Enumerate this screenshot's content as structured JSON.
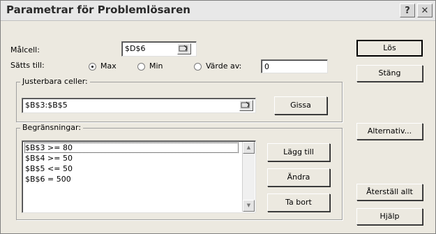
{
  "window": {
    "title": "Parametrar för Problemlösaren",
    "help_glyph": "?",
    "close_glyph": "✕"
  },
  "target": {
    "label": "Målcell:",
    "value": "$D$6"
  },
  "equal_to": {
    "label": "Sätts till:",
    "options": [
      "Max",
      "Min",
      "Värde av:"
    ],
    "selected": "Max",
    "value_of": "0"
  },
  "changing": {
    "label": "Justerbara celler:",
    "value": "$B$3:$B$5",
    "guess_button": "Gissa"
  },
  "constraints": {
    "label": "Begränsningar:",
    "items": [
      "$B$3 >= 80",
      "$B$4 >= 50",
      "$B$5 <= 50",
      "$B$6 = 500"
    ],
    "selected_index": 0,
    "add_button": "Lägg till",
    "change_button": "Ändra",
    "delete_button": "Ta bort"
  },
  "side_buttons": {
    "solve": "Lös",
    "close": "Stäng",
    "options": "Alternativ...",
    "reset": "Återställ allt",
    "help": "Hjälp"
  }
}
